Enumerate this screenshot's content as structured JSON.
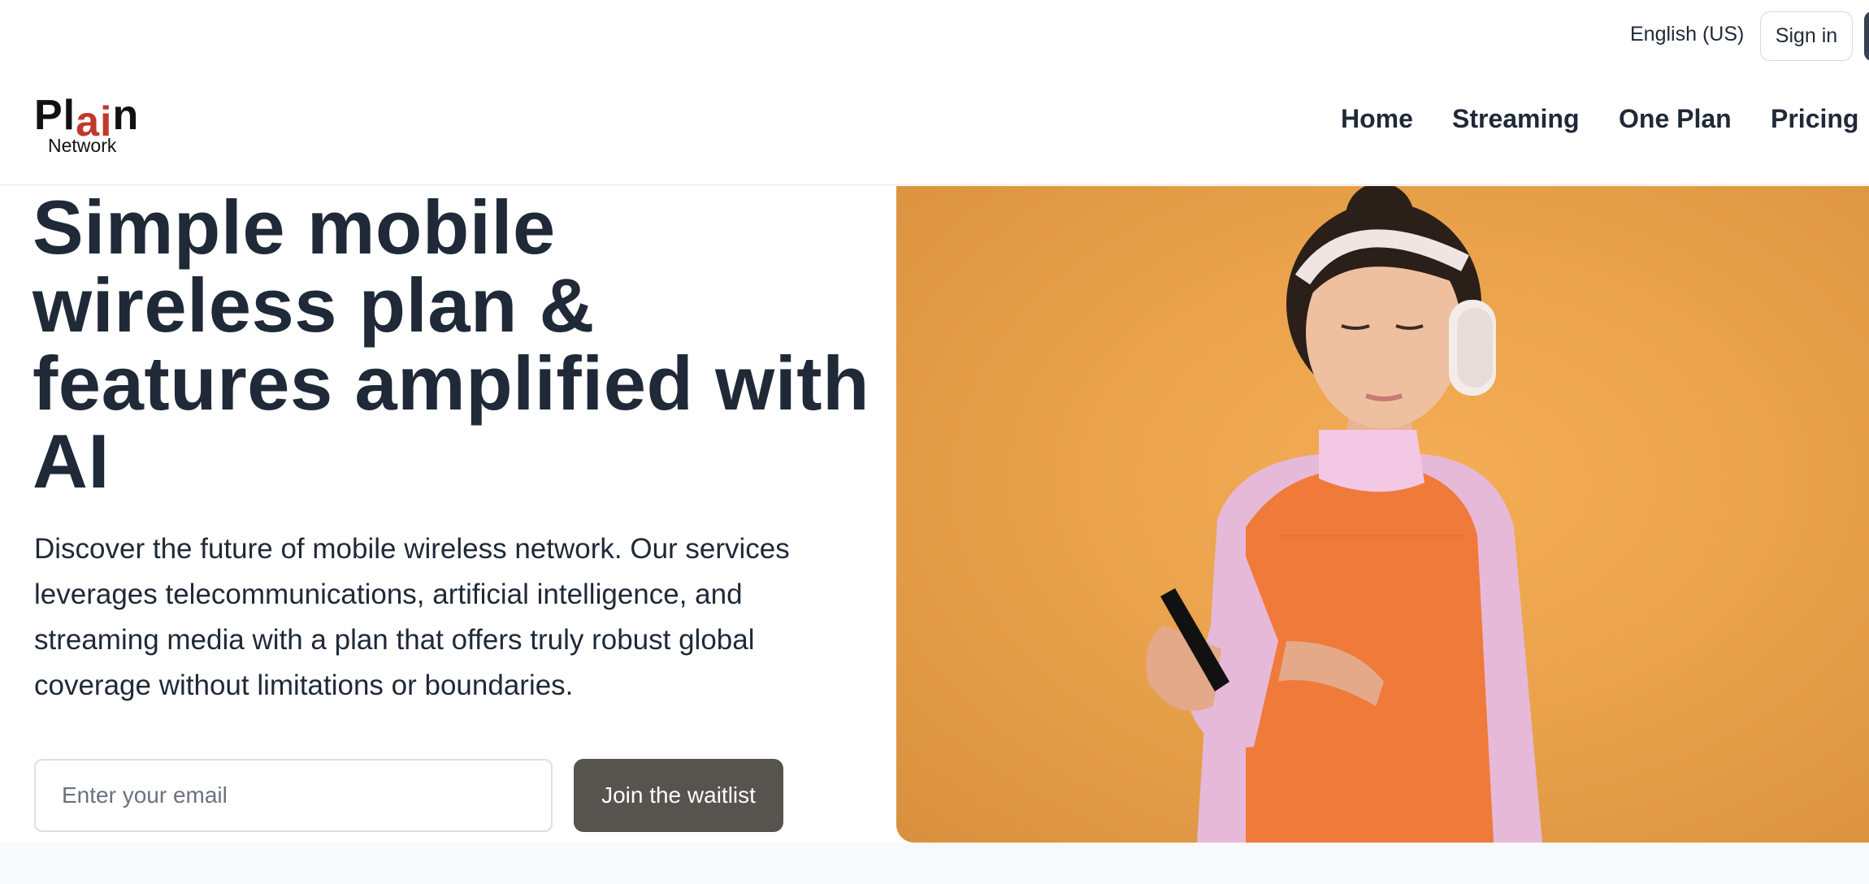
{
  "header": {
    "language": "English (US)",
    "sign_in": "Sign in"
  },
  "logo": {
    "pl": "Pl",
    "ai": "ai",
    "n": "n",
    "subtitle": "Network"
  },
  "nav": {
    "items": [
      "Home",
      "Streaming",
      "One Plan",
      "Pricing"
    ]
  },
  "hero": {
    "headline": "Simple mobile wireless plan & features amplified with AI",
    "description": "Discover the future of mobile wireless network. Our services leverages telecommunications, artificial intelligence, and streaming media with a plan that offers truly robust global coverage without limitations or boundaries.",
    "email_placeholder": "Enter your email",
    "email_value": "",
    "cta": "Join the waitlist"
  },
  "colors": {
    "text": "#1f2937",
    "logo_accent": "#c0392b",
    "cta_bg": "#57534e",
    "hero_bg": "#eaa34c",
    "top": "#e8e0d8",
    "vest": "#f07a3a"
  },
  "icons": {
    "hero_image": "woman-headphones-phone-image"
  }
}
